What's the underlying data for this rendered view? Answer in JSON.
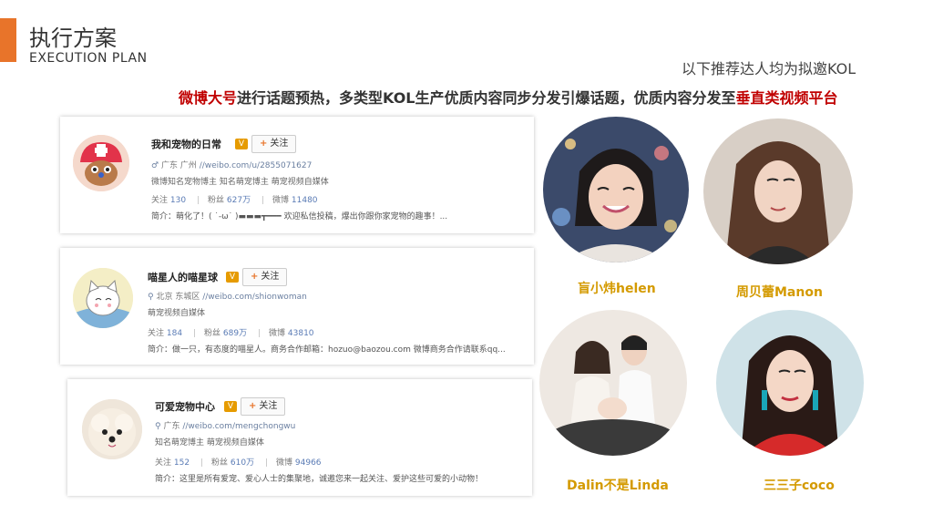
{
  "header": {
    "title": "执行方案",
    "subtitle": "EXECUTION  PLAN",
    "note": "以下推荐达人均为拟邀KOL"
  },
  "headline": {
    "lead_red": "微博大号",
    "middle": "进行话题预热，多类型KOL生产优质内容同步分发引爆话题，优质内容分发至",
    "tail_red": "垂直类视频平台"
  },
  "colors": {
    "accent": "#e8742a",
    "highlight_red": "#c00000",
    "kol_name_gold": "#d49a00"
  },
  "follow_label": "关注",
  "profiles": [
    {
      "name": "我和宠物的日常",
      "location": "广东 广州",
      "url": "//weibo.com/u/2855071627",
      "description": "微博知名宠物博主 知名萌宠博主 萌宠视频自媒体",
      "following_label": "关注",
      "following": "130",
      "fans_label": "粉丝",
      "fans": "627万",
      "posts_label": "微博",
      "posts": "11480",
      "bio": "简介：萌化了！( ˙-ω˙ )▬▬▬┳━━━ 欢迎私信投稿，爆出你跟你家宠物的趣事！..."
    },
    {
      "name": "喵星人的喵星球",
      "location": "北京 东城区",
      "url": "//weibo.com/shionwoman",
      "description": "萌宠视频自媒体",
      "following_label": "关注",
      "following": "184",
      "fans_label": "粉丝",
      "fans": "689万",
      "posts_label": "微博",
      "posts": "43810",
      "bio": "简介：做一只，有态度的喵星人。商务合作邮箱：hozuo@baozou.com 微博商务合作请联系qq..."
    },
    {
      "name": "可爱宠物中心",
      "location": "广东",
      "url": "//weibo.com/mengchongwu",
      "description": "知名萌宠博主 萌宠视频自媒体",
      "following_label": "关注",
      "following": "152",
      "fans_label": "粉丝",
      "fans": "610万",
      "posts_label": "微博",
      "posts": "94966",
      "bio": "简介：这里是所有爱宠、爱心人士的集聚地，诚邀您来一起关注、爱护这些可爱的小动物！"
    }
  ],
  "kols": [
    {
      "name": "盲小炜helen"
    },
    {
      "name": "周贝蕾Manon"
    },
    {
      "name": "Dalin不是Linda"
    },
    {
      "name": "三三子coco"
    }
  ]
}
